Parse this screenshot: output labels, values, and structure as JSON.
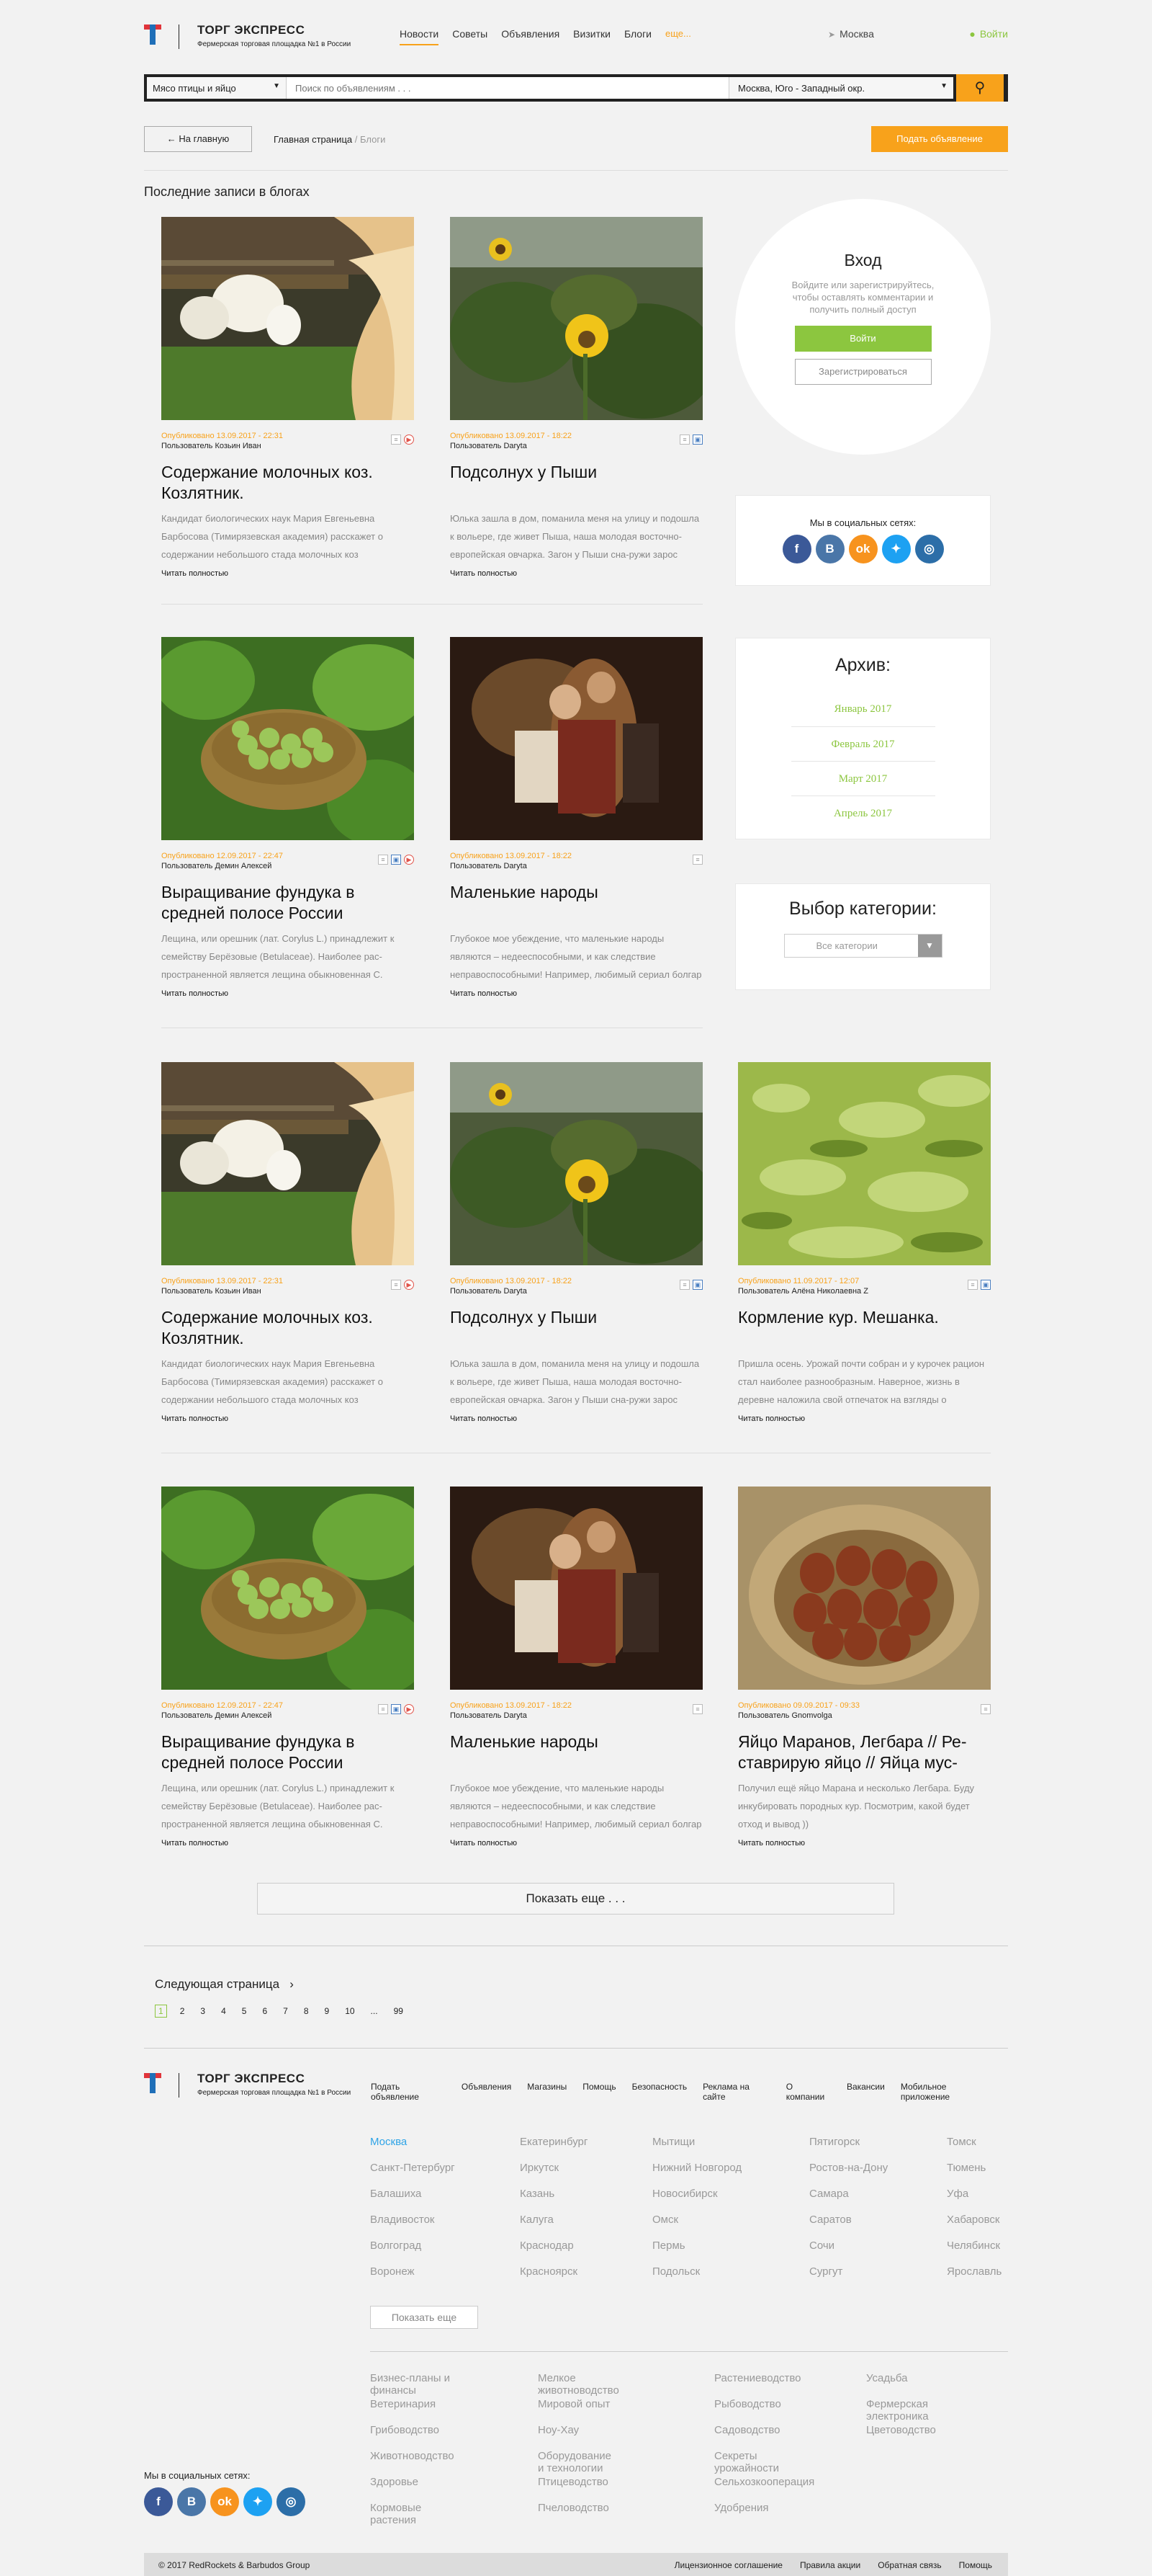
{
  "header": {
    "logo_title": "ТОРГ ЭКСПРЕСС",
    "logo_sub": "Фермерская торговая площадка №1 в России",
    "nav": [
      "Новости",
      "Советы",
      "Объявления",
      "Визитки",
      "Блоги"
    ],
    "nav_more": "еще...",
    "city": "Москва",
    "login": "Войти"
  },
  "search": {
    "category": "Мясо птицы и яйцо",
    "placeholder": "Поиск по объявлениям . . .",
    "region": "Москва, Юго - Западный окр."
  },
  "navrow": {
    "back": "На главную",
    "crumb_home": "Главная страница",
    "crumb_sep": "/",
    "crumb_current": "Блоги",
    "post_button": "Подать объявление"
  },
  "section_title": "Последние записи в блогах",
  "posts": [
    {
      "published": "Опубликовано 13.09.2017 - 22:31",
      "user": "Пользователь Козьин Иван",
      "title": "Содержание молочных коз. Козлятник.",
      "text": "Кандидат биологических наук Мария Евгеньевна Барбосова (Тимирязевская академия) расскажет о содержании небольшого стада молочных коз",
      "more": "Читать полностью"
    },
    {
      "published": "Опубликовано 13.09.2017 - 18:22",
      "user": "Пользователь Daryta",
      "title": "Подсолнух у Пыши",
      "text": "Юлька зашла в дом, поманила меня на улицу и подошла к вольере, где живет Пыша, наша молодая восточно-европейская овчарка. Загон у Пыши сна-ружи зарос крапивой. Даже когда она встает на",
      "more": "Читать полностью"
    },
    {
      "published": "Опубликовано 12.09.2017 - 22:47",
      "user": "Пользователь Демин Алексей",
      "title": "Выращивание фундука в средней полосе России",
      "text": "Лещина, или орешник (лат. Corylus L.) принадлежит к семейству Берёзовые (Betulaceae). Наиболее рас-пространенной является лещина обыкновенная С.",
      "more": "Читать полностью"
    },
    {
      "published": "Опубликовано 13.09.2017 - 18:22",
      "user": "Пользователь Daryta",
      "title": "Маленькие народы",
      "text": "Глубокое мое убеждение, что маленькие народы являются – недееспособными, и как следствие неправоспособными! Например, любимый сериал болгар на сейчас, это",
      "more": "Читать полностью"
    },
    {
      "published": "Опубликовано 13.09.2017 - 22:31",
      "user": "Пользователь Козьин Иван",
      "title": "Содержание молочных коз. Козлятник.",
      "text": "Кандидат биологических наук Мария Евгеньевна Барбосова (Тимирязевская академия) расскажет о содержании небольшого стада молочных коз",
      "more": "Читать полностью"
    },
    {
      "published": "Опубликовано 13.09.2017 - 18:22",
      "user": "Пользователь Daryta",
      "title": "Подсолнух у Пыши",
      "text": "Юлька зашла в дом, поманила меня на улицу и подошла к вольере, где живет Пыша, наша молодая восточно-европейская овчарка. Загон у Пыши сна-ружи зарос крапивой. Даже когда она встает на",
      "more": "Читать полностью"
    },
    {
      "published": "Опубликовано 11.09.2017 - 12:07",
      "user": "Пользователь Алёна Николаевна Z",
      "title": "Кормление кур. Мешанка.",
      "text": "Пришла осень. Урожай почти собран и у курочек рацион стал наиболее разнообразным. Наверное, жизнь в деревне наложила свой отпечаток на взгляды о содержании скотины и живи в СНТ, имея",
      "more": "Читать полностью"
    },
    {
      "published": "Опубликовано 12.09.2017 - 22:47",
      "user": "Пользователь Демин Алексей",
      "title": "Выращивание фундука в средней полосе России",
      "text": "Лещина, или орешник (лат. Corylus L.) принадлежит к семейству Берёзовые (Betulaceae). Наиболее рас-пространенной является лещина обыкновенная С.",
      "more": "Читать полностью"
    },
    {
      "published": "Опубликовано 13.09.2017 - 18:22",
      "user": "Пользователь Daryta",
      "title": "Маленькие народы",
      "text": "Глубокое мое убеждение, что маленькие народы являются – недееспособными, и как следствие неправоспособными! Например, любимый сериал болгар на сейчас, это",
      "more": "Читать полностью"
    },
    {
      "published": "Опубликовано 09.09.2017 - 09:33",
      "user": "Пользователь Gnomvolga",
      "title": "Яйцо Маранов, Легбара // Ре-ставрирую яйцо // Яйца мус-",
      "text": "Получил ещё яйцо Марана и несколько Легбара. Буду инкубировать породных кур. Посмотрим, какой будет отход и вывод ))",
      "more": "Читать полностью"
    }
  ],
  "sidebar": {
    "login_title": "Вход",
    "login_desc": "Войдите или зарегистрируйтесь, чтобы оставлять комментарии и получить полный доступ",
    "login_button": "Войти",
    "register_button": "Зарегистрироваться",
    "social_title": "Мы в социальных сетях:",
    "archive_title": "Архив:",
    "archive": [
      "Январь 2017",
      "Февраль 2017",
      "Март 2017",
      "Апрель 2017"
    ],
    "category_title": "Выбор категории:",
    "category_value": "Все категории"
  },
  "social": [
    "f",
    "B",
    "ok",
    "tw",
    "ig"
  ],
  "show_more": "Показать еще . . .",
  "next_page": "Следующая страница",
  "pager": [
    "1",
    "2",
    "3",
    "4",
    "5",
    "6",
    "7",
    "8",
    "9",
    "10",
    "...",
    "99"
  ],
  "footer": {
    "logo_title": "ТОРГ ЭКСПРЕСС",
    "logo_sub": "Фермерская торговая площадка №1 в России",
    "nav": [
      "Подать объявление",
      "Объявления",
      "Магазины",
      "Помощь",
      "Безопасность",
      "Реклама на сайте",
      "О компании",
      "Вакансии",
      "Мобильное приложение"
    ],
    "city_cols": [
      [
        "Москва",
        "Санкт-Петербург",
        "Балашиха",
        "Владивосток",
        "Волгоград",
        "Воронеж"
      ],
      [
        "Екатеринбург",
        "Иркутск",
        "Казань",
        "Калуга",
        "Краснодар",
        "Красноярск"
      ],
      [
        "Мытищи",
        "Нижний Новгород",
        "Новосибирск",
        "Омск",
        "Пермь",
        "Подольск"
      ],
      [
        "Пятигорск",
        "Ростов-на-Дону",
        "Самара",
        "Саратов",
        "Сочи",
        "Сургут"
      ],
      [
        "Томск",
        "Тюмень",
        "Уфа",
        "Хабаровск",
        "Челябинск",
        "Ярославль"
      ]
    ],
    "cities_more": "Показать еще",
    "cat_cols": [
      [
        "Бизнес-планы и финансы",
        "Ветеринария",
        "Грибоводство",
        "Животноводство",
        "Здоровье",
        "Кормовые растения"
      ],
      [
        "Мелкое животноводство",
        "Мировой опыт",
        "Ноу-Хау",
        "Оборудование и технологии",
        "Птицеводство",
        "Пчеловодство"
      ],
      [
        "Растениеводство",
        "Рыбоводство",
        "Садоводство",
        "Секреты урожайности",
        "Сельхозкооперация",
        "Удобрения"
      ],
      [
        "Усадьба",
        "Фермерская электроника",
        "Цветоводство"
      ]
    ],
    "social_title": "Мы в социальных сетях:",
    "copyright": "© 2017 RedRockets & Barbudos Group",
    "bottom_links": [
      "Лицензионное соглашение",
      "Правила акции",
      "Обратная связь",
      "Помощь"
    ]
  },
  "colors": {
    "accent": "#f8a21b",
    "green": "#8cc63f",
    "link_blue": "#2fa4e7"
  }
}
